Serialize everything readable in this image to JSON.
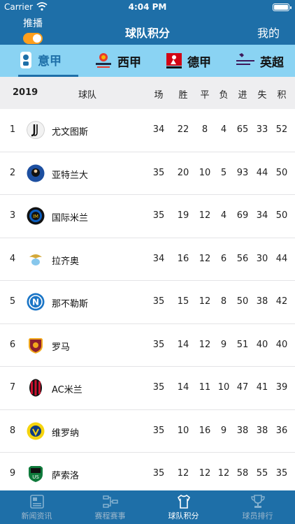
{
  "status_bar": {
    "carrier": "Carrier",
    "time": "4:04 PM"
  },
  "nav": {
    "push_label": "推播",
    "push_enabled": true,
    "title": "球队积分",
    "right_label": "我的"
  },
  "leagues": [
    {
      "label": "意甲",
      "icon": "serie-a-logo",
      "active": true
    },
    {
      "label": "西甲",
      "icon": "laliga-logo",
      "active": false
    },
    {
      "label": "德甲",
      "icon": "bundesliga-logo",
      "active": false
    },
    {
      "label": "英超",
      "icon": "premier-league-logo",
      "active": false
    }
  ],
  "table_header": {
    "season": "2019",
    "team": "球队",
    "played": "场",
    "won": "胜",
    "drawn": "平",
    "lost": "负",
    "goals_for": "进",
    "goals_against": "失",
    "points": "积"
  },
  "standings": [
    {
      "rank": "1",
      "team": "尤文图斯",
      "crest": "juventus-crest",
      "played": "34",
      "won": "22",
      "drawn": "8",
      "lost": "4",
      "gf": "65",
      "ga": "33",
      "pts": "52"
    },
    {
      "rank": "2",
      "team": "亚特兰大",
      "crest": "atalanta-crest",
      "played": "35",
      "won": "20",
      "drawn": "10",
      "lost": "5",
      "gf": "93",
      "ga": "44",
      "pts": "50"
    },
    {
      "rank": "3",
      "team": "国际米兰",
      "crest": "inter-crest",
      "played": "35",
      "won": "19",
      "drawn": "12",
      "lost": "4",
      "gf": "69",
      "ga": "34",
      "pts": "50"
    },
    {
      "rank": "4",
      "team": "拉齐奥",
      "crest": "lazio-crest",
      "played": "34",
      "won": "16",
      "drawn": "12",
      "lost": "6",
      "gf": "56",
      "ga": "30",
      "pts": "44"
    },
    {
      "rank": "5",
      "team": "那不勒斯",
      "crest": "napoli-crest",
      "played": "35",
      "won": "15",
      "drawn": "12",
      "lost": "8",
      "gf": "50",
      "ga": "38",
      "pts": "42"
    },
    {
      "rank": "6",
      "team": "罗马",
      "crest": "roma-crest",
      "played": "35",
      "won": "14",
      "drawn": "12",
      "lost": "9",
      "gf": "51",
      "ga": "40",
      "pts": "40"
    },
    {
      "rank": "7",
      "team": "AC米兰",
      "crest": "ac-milan-crest",
      "played": "35",
      "won": "14",
      "drawn": "11",
      "lost": "10",
      "gf": "47",
      "ga": "41",
      "pts": "39"
    },
    {
      "rank": "8",
      "team": "维罗纳",
      "crest": "verona-crest",
      "played": "35",
      "won": "10",
      "drawn": "16",
      "lost": "9",
      "gf": "38",
      "ga": "38",
      "pts": "36"
    },
    {
      "rank": "9",
      "team": "萨索洛",
      "crest": "sassuolo-crest",
      "played": "35",
      "won": "12",
      "drawn": "12",
      "lost": "12",
      "gf": "58",
      "ga": "55",
      "pts": "35"
    }
  ],
  "tabbar": [
    {
      "label": "新闻资讯",
      "icon": "news-icon",
      "active": false
    },
    {
      "label": "赛程赛事",
      "icon": "bracket-icon",
      "active": false
    },
    {
      "label": "球队积分",
      "icon": "jersey-icon",
      "active": true
    },
    {
      "label": "球员排行",
      "icon": "trophy-icon",
      "active": false
    }
  ],
  "colors": {
    "primary": "#1e6fa8",
    "league_bar": "#8ad3f3",
    "toggle": "#ff9f1c",
    "header_row": "#eeeef0"
  }
}
